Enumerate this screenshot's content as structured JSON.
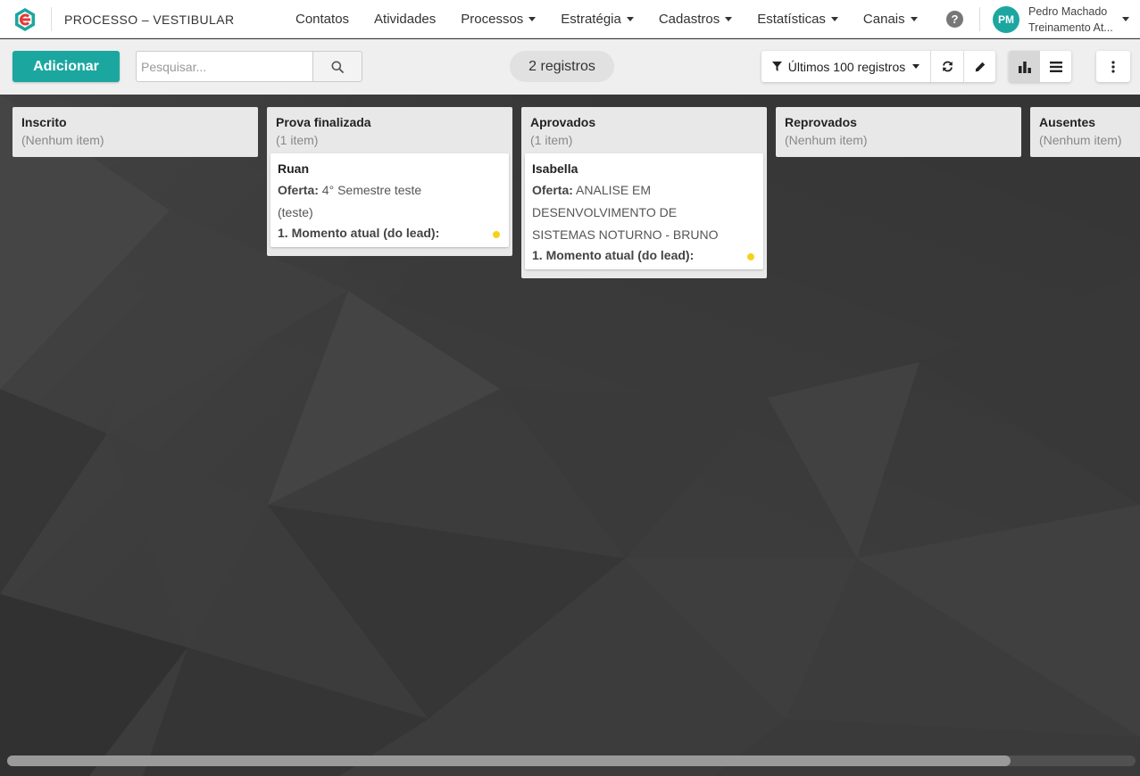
{
  "app": {
    "title": "PROCESSO – VESTIBULAR",
    "brand_color": "#1ba7a0"
  },
  "nav": {
    "items": [
      {
        "label": "Contatos",
        "dropdown": false
      },
      {
        "label": "Atividades",
        "dropdown": false
      },
      {
        "label": "Processos",
        "dropdown": true
      },
      {
        "label": "Estratégia",
        "dropdown": true
      },
      {
        "label": "Cadastros",
        "dropdown": true
      },
      {
        "label": "Estatísticas",
        "dropdown": true
      },
      {
        "label": "Canais",
        "dropdown": true
      }
    ],
    "help_icon": "?"
  },
  "user": {
    "initials": "PM",
    "name": "Pedro Machado",
    "subtitle": "Treinamento At..."
  },
  "toolbar": {
    "add_label": "Adicionar",
    "search_placeholder": "Pesquisar...",
    "records_count": "2 registros",
    "filter_label": "Últimos 100 registros"
  },
  "columns": [
    {
      "title": "Inscrito",
      "count": "(Nenhum item)",
      "cards": []
    },
    {
      "title": "Prova finalizada",
      "count": "(1 item)",
      "cards": [
        {
          "name": "Ruan",
          "offer_label": "Oferta:",
          "offer_lines": [
            "4° Semestre teste",
            "(teste)"
          ],
          "moment": "1. Momento atual (do lead):"
        }
      ]
    },
    {
      "title": "Aprovados",
      "count": "(1 item)",
      "cards": [
        {
          "name": "Isabella",
          "offer_label": "Oferta:",
          "offer_lines": [
            "ANALISE EM",
            "DESENVOLVIMENTO DE",
            "SISTEMAS NOTURNO - BRUNO"
          ],
          "moment": "1. Momento atual (do lead):"
        }
      ]
    },
    {
      "title": "Reprovados",
      "count": "(Nenhum item)",
      "cards": []
    },
    {
      "title": "Ausentes",
      "count": "(Nenhum item)",
      "cards": []
    }
  ],
  "colors": {
    "status_dot": "#f4d21b",
    "column_bg": "#e8e8e8"
  }
}
